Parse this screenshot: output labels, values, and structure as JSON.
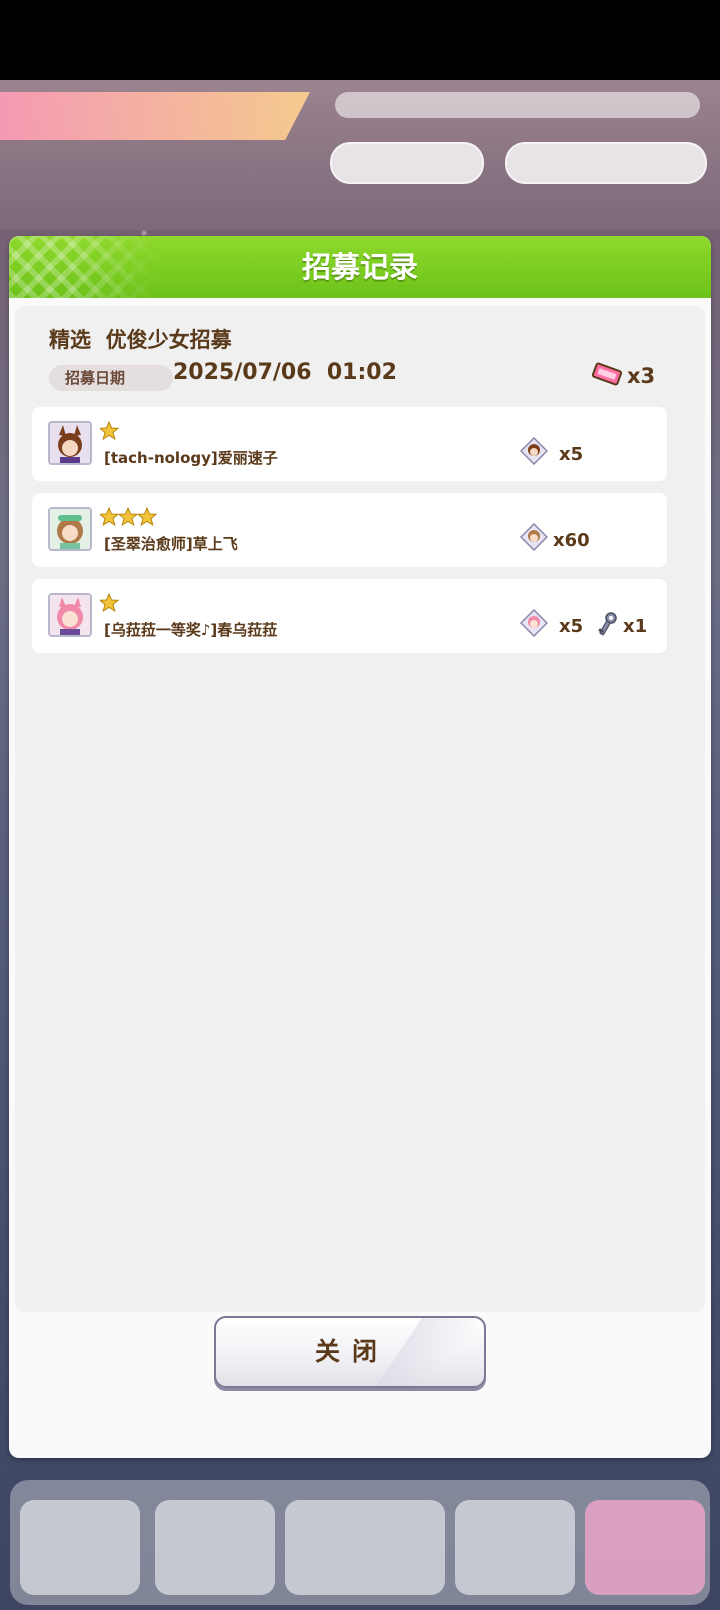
{
  "dialog": {
    "title": "招募记录",
    "gacha_name": "精选  优俊少女招募",
    "date_label": "招募日期",
    "date_value": "2025/07/06  01:02",
    "ticket_count": "x3",
    "close_label": "关闭"
  },
  "records": [
    {
      "name": "[tach-nology]爱丽速子",
      "stars": 1,
      "piece_count": "x5"
    },
    {
      "name": "[圣翠治愈师]草上飞",
      "stars": 3,
      "piece_count": "x60"
    },
    {
      "name": "[乌菈菈一等奖♪]春乌菈菈",
      "stars": 1,
      "piece_count": "x5",
      "key_count": "x1"
    }
  ],
  "colors": {
    "header_green": "#7acb1f",
    "text_brown": "#5a3a1a",
    "star_gold": "#f2c23a"
  }
}
